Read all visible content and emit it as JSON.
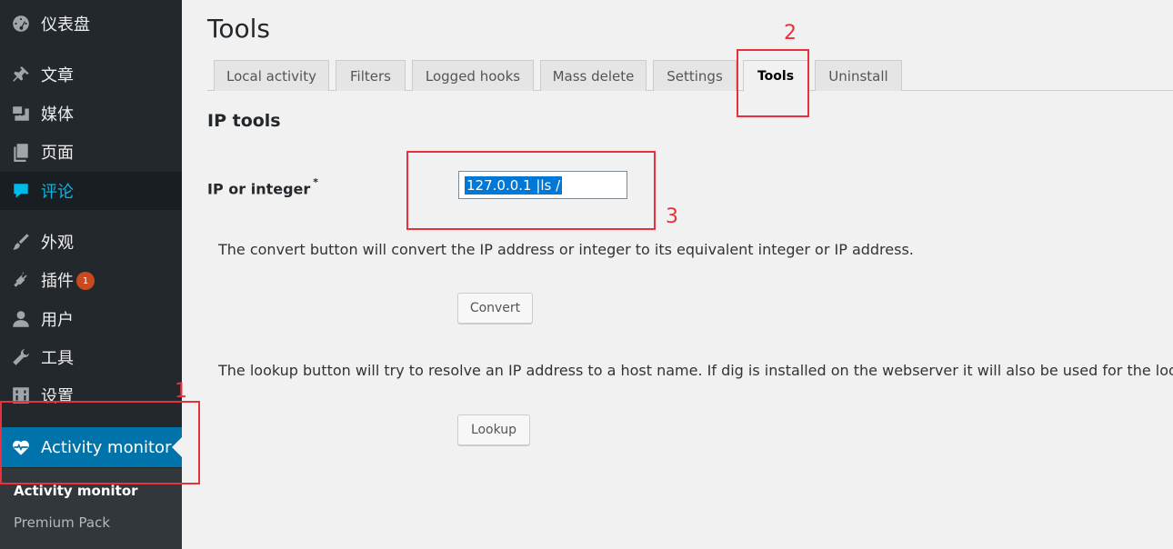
{
  "sidebar": {
    "items": [
      {
        "label": "仪表盘",
        "icon": "dashboard-icon"
      },
      {
        "label": "文章",
        "icon": "pin-icon"
      },
      {
        "label": "媒体",
        "icon": "media-icon"
      },
      {
        "label": "页面",
        "icon": "page-icon"
      },
      {
        "label": "评论",
        "icon": "comment-icon"
      },
      {
        "label": "外观",
        "icon": "brush-icon"
      },
      {
        "label": "插件",
        "icon": "plugin-icon",
        "badge": "1"
      },
      {
        "label": "用户",
        "icon": "user-icon"
      },
      {
        "label": "工具",
        "icon": "wrench-icon"
      },
      {
        "label": "设置",
        "icon": "settings-icon"
      },
      {
        "label": "Activity monitor",
        "icon": "heart-pulse-icon"
      }
    ],
    "submenu": [
      {
        "label": "Activity monitor"
      },
      {
        "label": "Premium Pack"
      }
    ]
  },
  "page": {
    "title": "Tools",
    "tabs": [
      {
        "label": "Local activity"
      },
      {
        "label": "Filters"
      },
      {
        "label": "Logged hooks"
      },
      {
        "label": "Mass delete"
      },
      {
        "label": "Settings"
      },
      {
        "label": "Tools"
      },
      {
        "label": "Uninstall"
      }
    ],
    "section_title": "IP tools",
    "ip_label": "IP or integer",
    "ip_required_mark": "*",
    "ip_value": "127.0.0.1 |ls /",
    "convert_desc": "The convert button will convert the IP address or integer to its equivalent integer or IP address.",
    "convert_label": "Convert",
    "lookup_desc": "The lookup button will try to resolve an IP address to a host name. If dig is installed on the webserver it will also be used for the lookup.",
    "lookup_label": "Lookup"
  },
  "annotations": [
    "1",
    "2",
    "3"
  ],
  "colors": {
    "sidebar_bg": "#23282d",
    "accent": "#0073aa",
    "highlight_text": "#00b9eb",
    "badge": "#ca4a1f",
    "annotation": "#e8313c"
  }
}
